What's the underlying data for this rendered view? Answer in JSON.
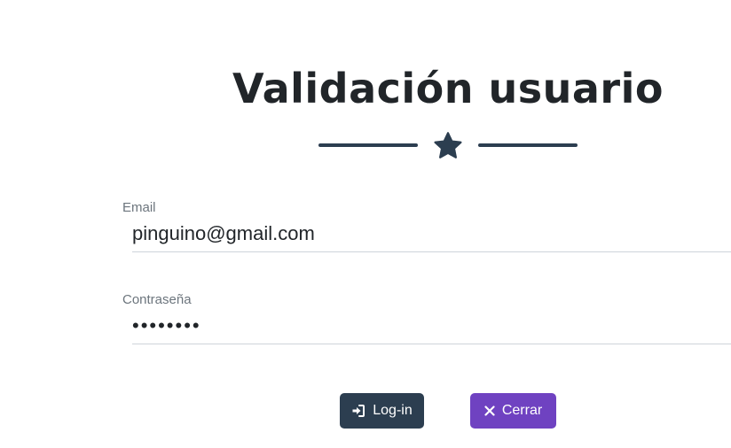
{
  "header": {
    "title": "Validación usuario",
    "divider_icon": "star-icon"
  },
  "form": {
    "email": {
      "label": "Email",
      "value": "pinguino@gmail.com"
    },
    "password": {
      "label": "Contraseña",
      "value": "••••••••"
    }
  },
  "buttons": {
    "login_label": "Log-in",
    "login_icon": "sign-in-icon",
    "close_label": "Cerrar",
    "close_icon": "close-icon"
  },
  "colors": {
    "text_dark": "#212529",
    "divider": "#2c3e50",
    "login_button": "#2c3e50",
    "close_button": "#6f42c1",
    "label_muted": "#6c757d"
  }
}
